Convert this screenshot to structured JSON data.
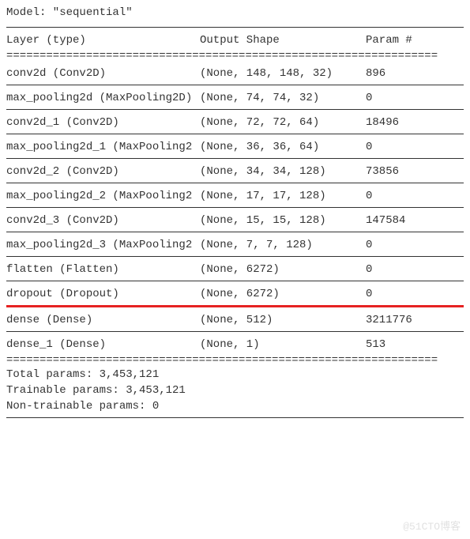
{
  "model_title": "Model: \"sequential\"",
  "headers": {
    "layer": "Layer (type)",
    "shape": "Output Shape",
    "param": "Param #"
  },
  "double_rule": "=================================================================",
  "layers_top": [
    {
      "layer": "conv2d (Conv2D)",
      "shape": "(None, 148, 148, 32)",
      "param": "896"
    },
    {
      "layer": "max_pooling2d (MaxPooling2D)",
      "shape": "(None, 74, 74, 32)",
      "param": "0"
    },
    {
      "layer": "conv2d_1 (Conv2D)",
      "shape": "(None, 72, 72, 64)",
      "param": "18496"
    },
    {
      "layer": "max_pooling2d_1 (MaxPooling2",
      "shape": "(None, 36, 36, 64)",
      "param": "0"
    },
    {
      "layer": "conv2d_2 (Conv2D)",
      "shape": "(None, 34, 34, 128)",
      "param": "73856"
    },
    {
      "layer": "max_pooling2d_2 (MaxPooling2",
      "shape": "(None, 17, 17, 128)",
      "param": "0"
    },
    {
      "layer": "conv2d_3 (Conv2D)",
      "shape": "(None, 15, 15, 128)",
      "param": "147584"
    },
    {
      "layer": "max_pooling2d_3 (MaxPooling2",
      "shape": "(None, 7, 7, 128)",
      "param": "0"
    },
    {
      "layer": "flatten (Flatten)",
      "shape": "(None, 6272)",
      "param": "0"
    },
    {
      "layer": "dropout (Dropout)",
      "shape": "(None, 6272)",
      "param": "0"
    }
  ],
  "layers_bottom": [
    {
      "layer": "dense (Dense)",
      "shape": "(None, 512)",
      "param": "3211776"
    },
    {
      "layer": "dense_1 (Dense)",
      "shape": "(None, 1)",
      "param": "513"
    }
  ],
  "footer": {
    "total": "Total params: 3,453,121",
    "trainable": "Trainable params: 3,453,121",
    "nontrainable": "Non-trainable params: 0"
  },
  "watermark": "@51CTO博客"
}
